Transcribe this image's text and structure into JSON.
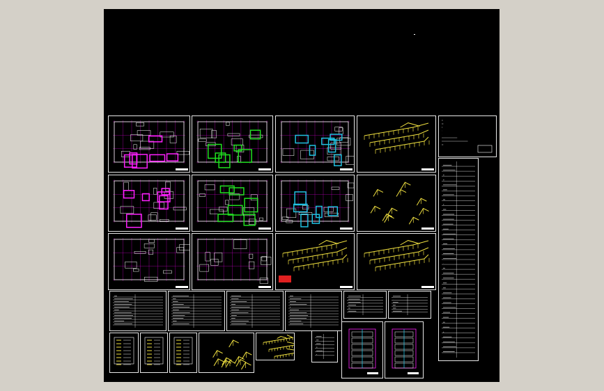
{
  "viewer": {
    "background_color": "#d4d0c8",
    "canvas_color": "#000000"
  },
  "colors": {
    "frame": "#e8e8e8",
    "grid": "#b000b0",
    "magenta": "#ff20ff",
    "green": "#20e020",
    "cyan": "#20c0e0",
    "yellow": "#f0e040",
    "red": "#e02020",
    "white": "#ffffff"
  },
  "sheets": [
    {
      "id": "plan-1",
      "kind": "plan",
      "accent": "magenta"
    },
    {
      "id": "plan-2",
      "kind": "plan",
      "accent": "green"
    },
    {
      "id": "plan-3",
      "kind": "plan",
      "accent": "cyan"
    },
    {
      "id": "iso-1",
      "kind": "iso"
    },
    {
      "id": "notes-1",
      "kind": "notes"
    },
    {
      "id": "plan-4",
      "kind": "plan",
      "accent": "magenta"
    },
    {
      "id": "plan-5",
      "kind": "plan",
      "accent": "green"
    },
    {
      "id": "plan-6",
      "kind": "plan",
      "accent": "cyan"
    },
    {
      "id": "iso-2",
      "kind": "iso-details"
    },
    {
      "id": "plan-7",
      "kind": "plan",
      "accent": "none"
    },
    {
      "id": "plan-8",
      "kind": "plan",
      "accent": "none"
    },
    {
      "id": "iso-3",
      "kind": "iso",
      "badge": "red"
    },
    {
      "id": "iso-4",
      "kind": "iso"
    },
    {
      "id": "table-1",
      "kind": "table"
    },
    {
      "id": "table-2",
      "kind": "table"
    },
    {
      "id": "table-3",
      "kind": "table"
    },
    {
      "id": "table-4",
      "kind": "table"
    },
    {
      "id": "tbl-small-1",
      "kind": "table-small"
    },
    {
      "id": "tbl-small-2",
      "kind": "table-small"
    },
    {
      "id": "legend-1",
      "kind": "legend"
    },
    {
      "id": "legend-2",
      "kind": "legend"
    },
    {
      "id": "legend-3",
      "kind": "legend"
    },
    {
      "id": "iso-5",
      "kind": "iso-details"
    },
    {
      "id": "iso-6",
      "kind": "iso-small"
    },
    {
      "id": "tbl-small-3",
      "kind": "table-small"
    },
    {
      "id": "narrow-1",
      "kind": "narrow-plan"
    },
    {
      "id": "narrow-2",
      "kind": "narrow-plan"
    },
    {
      "id": "long-list",
      "kind": "long-table"
    }
  ]
}
